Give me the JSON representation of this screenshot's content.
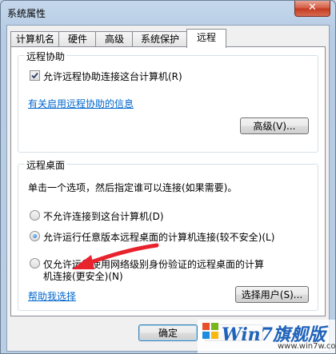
{
  "window": {
    "title": "系统属性",
    "close_label": "✕"
  },
  "tabs": [
    {
      "label": "计算机名"
    },
    {
      "label": "硬件"
    },
    {
      "label": "高级"
    },
    {
      "label": "系统保护"
    },
    {
      "label": "远程",
      "active": true
    }
  ],
  "remote_assistance": {
    "group_label": "远程协助",
    "allow_label": "允许远程协助连接这台计算机(R)",
    "allow_checked": true,
    "info_link": "有关启用远程协助的信息",
    "advanced_button": "高级(V)..."
  },
  "remote_desktop": {
    "group_label": "远程桌面",
    "instruction": "单击一个选项，然后指定谁可以连接(如果需要)。",
    "options": [
      {
        "label": "不允许连接到这台计算机(D)",
        "selected": false
      },
      {
        "label": "允许运行任意版本远程桌面的计算机连接(较不安全)(L)",
        "selected": true
      },
      {
        "label_line1": "仅允许运行使用网络级别身份验证的远程桌面的计算",
        "label_line2": "机连接(更安全)(N)",
        "selected": false
      }
    ],
    "help_link": "帮助我选择",
    "select_users_button": "选择用户(S)..."
  },
  "footer": {
    "ok_button": "确定"
  },
  "watermark": {
    "brand": "Win7旗舰版",
    "site": "www.win7w.com"
  },
  "colors": {
    "accent_link": "#0066cc",
    "arrow": "#e8232e",
    "watermark_brand": "#1f62b9"
  }
}
